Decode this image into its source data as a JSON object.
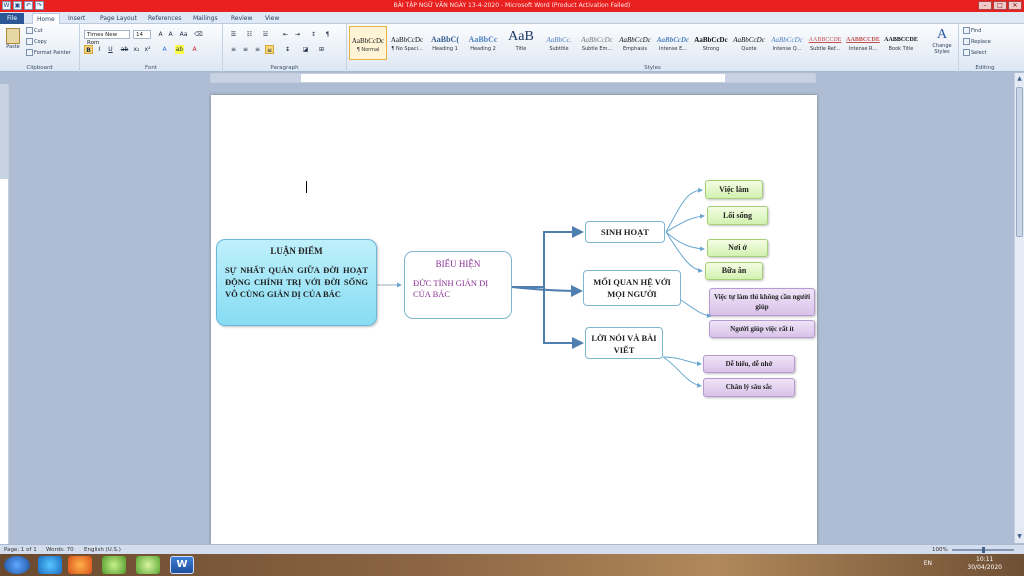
{
  "window": {
    "title": "BÀI TẬP NGỮ VĂN NGÀY 13-4-2020  -  Microsoft Word (Product Activation Failed)"
  },
  "tabs": [
    "File",
    "Home",
    "Insert",
    "Page Layout",
    "References",
    "Mailings",
    "Review",
    "View"
  ],
  "clipboard": {
    "paste": "Paste",
    "cut": "Cut",
    "copy": "Copy",
    "format_painter": "Format Painter",
    "label": "Clipboard"
  },
  "font": {
    "name": "Times New Rom",
    "size": "14",
    "label": "Font"
  },
  "paragraph": {
    "label": "Paragraph"
  },
  "styles": {
    "label": "Styles",
    "items": [
      {
        "sample": "AaBbCcDc",
        "name": "¶ Normal"
      },
      {
        "sample": "AaBbCcDc",
        "name": "¶ No Spaci..."
      },
      {
        "sample": "AaBbC(",
        "name": "Heading 1"
      },
      {
        "sample": "AaBbCc",
        "name": "Heading 2"
      },
      {
        "sample": "AaB",
        "name": "Title"
      },
      {
        "sample": "AaBbCc.",
        "name": "Subtitle"
      },
      {
        "sample": "AaBbCcDc",
        "name": "Subtle Em..."
      },
      {
        "sample": "AaBbCcDc",
        "name": "Emphasis"
      },
      {
        "sample": "AaBbCcDc",
        "name": "Intense E..."
      },
      {
        "sample": "AaBbCcDc",
        "name": "Strong"
      },
      {
        "sample": "AaBbCcDc",
        "name": "Quote"
      },
      {
        "sample": "AaBbCcDc",
        "name": "Intense Q..."
      },
      {
        "sample": "AABBCCDE",
        "name": "Subtle Ref..."
      },
      {
        "sample": "AABBCCDE",
        "name": "Intense R..."
      },
      {
        "sample": "AABBCCDE",
        "name": "Book Title"
      }
    ],
    "change_styles": "Change Styles"
  },
  "editing": {
    "find": "Find",
    "replace": "Replace",
    "select": "Select",
    "label": "Editing"
  },
  "diagram": {
    "main_heading": "LUẬN ĐIỂM",
    "main_body": "Sự nhất quán giữa đời hoạt động chính trị với đời sống vô cùng giản dị của Bác",
    "bieu_heading": "BIỂU HIỆN",
    "bieu_body": "ĐỨC TÍNH GIẢN DỊ CỦA BÁC",
    "sinh_hoat": "SINH HOẠT",
    "moi_quan_he": "MỐI QUAN HỆ VỚI MỌI NGƯỜI",
    "loi_noi": "LỜI NÓI VÀ BÀI VIẾT",
    "leaf_viec_lam": "Việc làm",
    "leaf_loi_song": "Lối sống",
    "leaf_noi_o": "Nơi ở",
    "leaf_bua_an": "Bữa ăn",
    "leaf_viec_tu_lam": "Việc tự làm thì không cần người giúp",
    "leaf_nguoi_giup": "Người giúp việc rất ít",
    "leaf_de_hieu": "Dễ hiểu, dễ nhớ",
    "leaf_chan_ly": "Chân lý sâu sắc"
  },
  "status": {
    "page": "Page: 1 of 1",
    "words": "Words: 70",
    "language": "English (U.S.)",
    "zoom": "100%"
  },
  "taskbar": {
    "lang": "EN",
    "time": "10:11",
    "date": "30/04/2020"
  },
  "colors": {
    "titlebar": "#e8201f",
    "accent": "#2b5797",
    "connector": "#4f7fb0"
  }
}
